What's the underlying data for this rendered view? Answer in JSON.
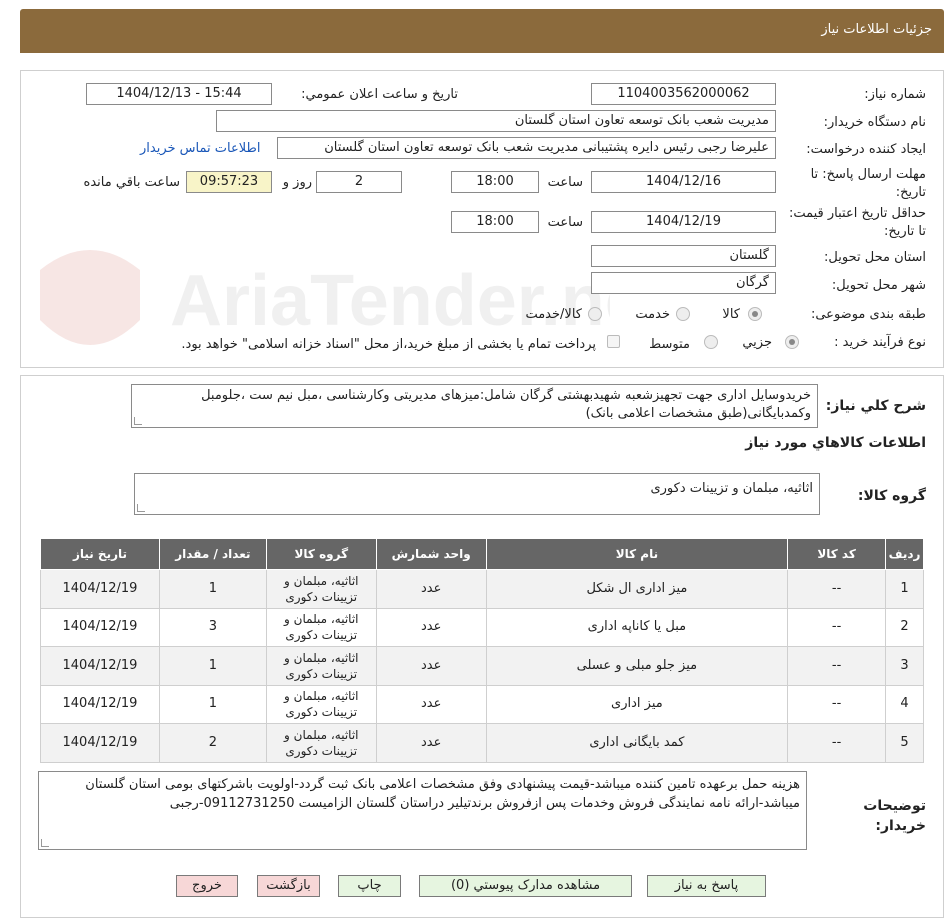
{
  "header": {
    "title": "جزئیات اطلاعات نیاز"
  },
  "info": {
    "need_number_label": "شماره نیاز:",
    "need_number": "1104003562000062",
    "announce_label": "تاریخ و ساعت اعلان عمومي:",
    "announce_value": "1404/12/13 - 15:44",
    "buyer_org_label": "نام دستگاه خريدار:",
    "buyer_org": "مدیریت شعب بانک توسعه تعاون استان گلستان",
    "requester_label": "ایجاد کننده درخواست:",
    "requester": "علیرضا رجبی رئیس دایره پشتیبانی مدیریت شعب بانک توسعه تعاون استان گلستان",
    "contact_link": "اطلاعات تماس خریدار",
    "deadline_label": "مهلت ارسال پاسخ: تا تاریخ:",
    "deadline_date": "1404/12/16",
    "time_label": "ساعت",
    "deadline_time": "18:00",
    "days_value": "2",
    "days_label": "روز و",
    "remaining_time": "09:57:23",
    "remaining_label": "ساعت باقي مانده",
    "validity_label": "حداقل تاريخ اعتبار قيمت: تا تاريخ:",
    "validity_date": "1404/12/19",
    "validity_time": "18:00",
    "province_label": "استان محل تحویل:",
    "province": "گلستان",
    "city_label": "شهر محل تحویل:",
    "city": "گرگان",
    "category_label": "طبقه بندی موضوعی:",
    "category_options": [
      "کالا",
      "خدمت",
      "کالا/خدمت"
    ],
    "category_selected": "کالا",
    "process_label": "نوع فرآیند خرید :",
    "process_options": [
      "جزیي",
      "متوسط"
    ],
    "process_selected": "جزیي",
    "payment_note": "پرداخت تمام یا بخشی از مبلغ خرید،از محل \"اسناد خزانه اسلامی\" خواهد بود."
  },
  "summary": {
    "desc_label": "شرح کلي نیاز:",
    "desc_text": "خریدوسایل اداری جهت تجهیزشعبه شهیدبهشتی گرگان شامل:میزهای مدیریتی وکارشناسی ،مبل نیم ست ،جلومبل وکمدبایگانی(طبق مشخصات اعلامی بانک)",
    "goods_info_title": "اطلاعات کالاهاي مورد نیاز",
    "goods_group_label": "گروه کالا:",
    "goods_group_value": "اثاثیه، مبلمان و تزیینات دکوری"
  },
  "table": {
    "headers": [
      "رديف",
      "کد کالا",
      "نام کالا",
      "واحد شمارش",
      "گروه کالا",
      "تعداد / مقدار",
      "تاريخ نياز"
    ],
    "rows": [
      [
        "1",
        "--",
        "میز اداری ال شکل",
        "عدد",
        "اثاثیه، مبلمان و تزیینات دکوری",
        "1",
        "1404/12/19"
      ],
      [
        "2",
        "--",
        "مبل یا کاناپه اداری",
        "عدد",
        "اثاثیه، مبلمان و تزیینات دکوری",
        "3",
        "1404/12/19"
      ],
      [
        "3",
        "--",
        "میز جلو مبلی و عسلی",
        "عدد",
        "اثاثیه، مبلمان و تزیینات دکوری",
        "1",
        "1404/12/19"
      ],
      [
        "4",
        "--",
        "میز اداری",
        "عدد",
        "اثاثیه، مبلمان و تزیینات دکوری",
        "1",
        "1404/12/19"
      ],
      [
        "5",
        "--",
        "کمد بایگانی اداری",
        "عدد",
        "اثاثیه، مبلمان و تزیینات دکوری",
        "2",
        "1404/12/19"
      ]
    ]
  },
  "buyer_notes": {
    "label": "توضیحات خریدار:",
    "text": "هزینه حمل برعهده تامین کننده میباشد-قیمت پیشنهادی وفق مشخصات اعلامی بانک ثبت گردد-اولویت باشرکتهای بومی استان گلستان میباشد-ارائه نامه نمایندگی فروش وخدمات پس ازفروش برندتیلیر  دراستان گلستان الزامیست 09112731250-رجبی"
  },
  "buttons": {
    "respond": "پاسخ به نیاز",
    "view_docs": "مشاهده مدارک پیوستي (0)",
    "print": "چاپ",
    "back": "بازگشت",
    "exit": "خروج"
  },
  "colors": {
    "header_bg": "#8b6a3c",
    "table_header_bg": "#666666",
    "link": "#1a57b8",
    "exit_btn": "#f7d7d7",
    "back_btn": "#f7d7d7",
    "green_btn": "#e6f5e0",
    "remaining_bg": "#f8f4c8"
  }
}
